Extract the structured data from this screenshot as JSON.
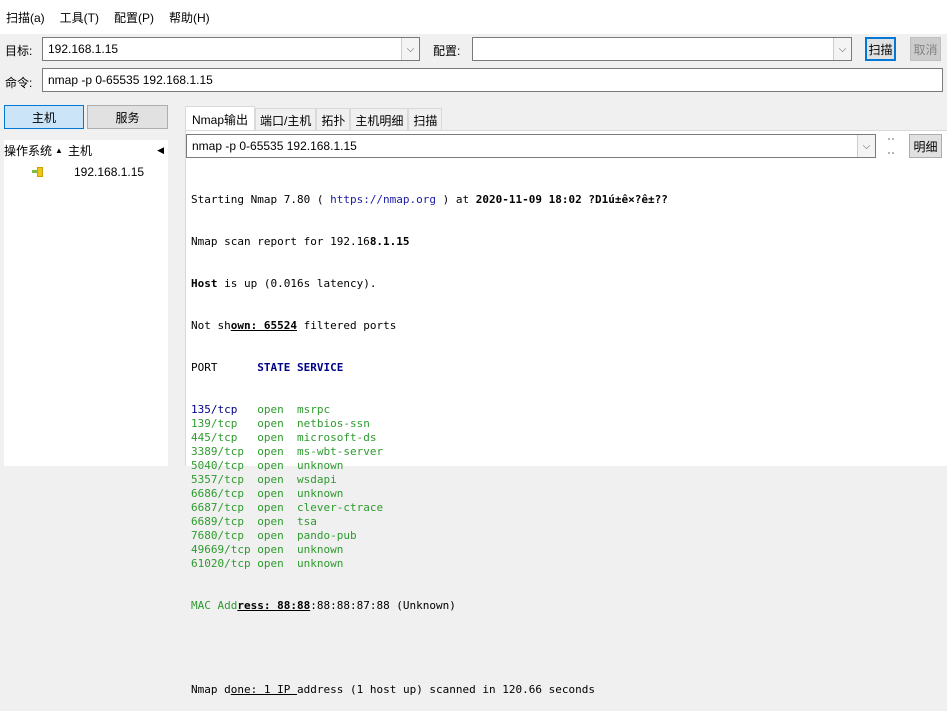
{
  "menu": [
    {
      "label": "扫描(a)"
    },
    {
      "label": "工具(T)"
    },
    {
      "label": "配置(P)"
    },
    {
      "label": "帮助(H)"
    }
  ],
  "target": {
    "label": "目标:",
    "value": "192.168.1.15"
  },
  "profile": {
    "label": "配置:",
    "value": ""
  },
  "scan_button": "扫描",
  "cancel_button": "取消",
  "command": {
    "label": "命令:",
    "value": "nmap -p 0-65535 192.168.1.15"
  },
  "left": {
    "hosts_button": "主机",
    "services_button": "服务",
    "col_os": "操作系统",
    "col_host": "主机",
    "hosts": [
      {
        "ip": "192.168.1.15"
      }
    ]
  },
  "tabs": [
    "Nmap输出",
    "端口/主机",
    "拓扑",
    "主机明细",
    "扫描"
  ],
  "output_select": {
    "value": "nmap -p 0-65535 192.168.1.15"
  },
  "details_button": "明细",
  "output": {
    "line1_a": "Starting Nmap 7.80 ( ",
    "line1_link": "https://nmap.org",
    "line1_b": " ) at ",
    "line1_date": "2020-11-09 18:02 ?D1ú±ê×?ê±??",
    "line2_a": "Nmap scan report for 192.16",
    "line2_b": "8.1.15",
    "line3_a": "Host",
    "line3_b": " is up (0.016s latency).",
    "line4_a": "Not sh",
    "line4_b": "own: 65524",
    "line4_c": " filtered ports",
    "header_port": "PORT      ",
    "header_rest": "STATE SERVICE",
    "ports": [
      {
        "port": "135/tcp  ",
        "state": " open  ",
        "service": "msrpc",
        "first": true
      },
      {
        "port": "139/tcp  ",
        "state": " open  ",
        "service": "netbios-ssn"
      },
      {
        "port": "445/tcp  ",
        "state": " open  ",
        "service": "microsoft-ds"
      },
      {
        "port": "3389/tcp ",
        "state": " open  ",
        "service": "ms-wbt-server"
      },
      {
        "port": "5040/tcp ",
        "state": " open  ",
        "service": "unknown"
      },
      {
        "port": "5357/tcp ",
        "state": " open  ",
        "service": "wsdapi"
      },
      {
        "port": "6686/tcp ",
        "state": " open  ",
        "service": "unknown"
      },
      {
        "port": "6687/tcp ",
        "state": " open  ",
        "service": "clever-ctrace"
      },
      {
        "port": "6689/tcp ",
        "state": " open  ",
        "service": "tsa"
      },
      {
        "port": "7680/tcp ",
        "state": " open  ",
        "service": "pando-pub"
      },
      {
        "port": "49669/tcp",
        "state": " open  ",
        "service": "unknown"
      },
      {
        "port": "61020/tcp",
        "state": " open  ",
        "service": "unknown"
      }
    ],
    "mac_a": "MAC Add",
    "mac_b": "ress: 88:88",
    "mac_c": ":88:88:87:88 (Unknown)",
    "done_a": "Nmap d",
    "done_b": "one: 1 IP ",
    "done_c": "address (1 host up) scanned in 120.66 seconds"
  },
  "colors": {
    "accent": "#0078d7",
    "port_green": "#2e9b2e",
    "keyword_blue": "#00008b"
  }
}
